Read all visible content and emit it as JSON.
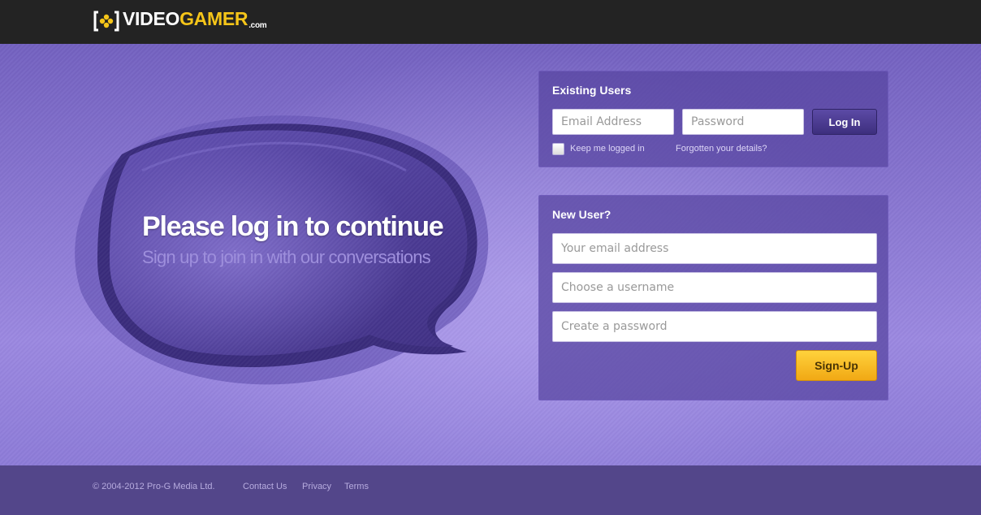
{
  "header": {
    "logo": {
      "icon": "gamepad-bracket-icon",
      "text_main": "VIDEO",
      "text_accent": "GAMER",
      "text_suffix": ".com",
      "accent_color": "#f5c519"
    }
  },
  "hero": {
    "title": "Please log in to continue",
    "subtitle": "Sign up to join in with our conversations"
  },
  "existing_users": {
    "title": "Existing Users",
    "email_placeholder": "Email Address",
    "password_placeholder": "Password",
    "login_label": "Log In",
    "remember_label": "Keep me logged in",
    "remember_checked": false,
    "forgot_label": "Forgotten your details?"
  },
  "new_user": {
    "title": "New User?",
    "email_placeholder": "Your email address",
    "username_placeholder": "Choose a username",
    "password_placeholder": "Create a password",
    "signup_label": "Sign-Up"
  },
  "footer": {
    "copyright": "© 2004-2012 Pro-G Media Ltd.",
    "links": [
      "Contact Us",
      "Privacy",
      "Terms"
    ]
  },
  "colors": {
    "background": "#8a78d6",
    "topbar": "#232323",
    "footer": "#53468a",
    "signup_button": "#f7bf26",
    "login_button": "#4a3b92"
  }
}
